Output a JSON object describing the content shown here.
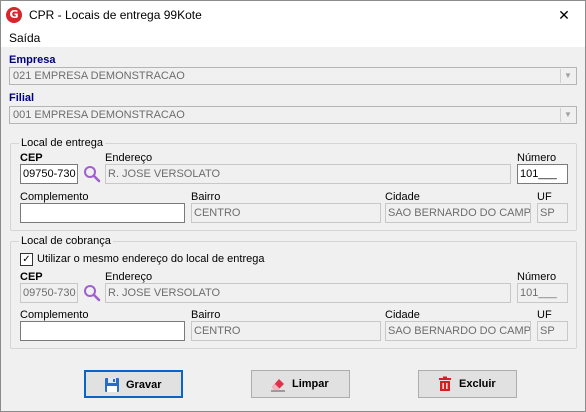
{
  "window": {
    "title": "CPR - Locais de entrega 99Kote",
    "app_icon": "G",
    "close_glyph": "✕"
  },
  "menu": {
    "items": [
      "Saída"
    ]
  },
  "empresa": {
    "label": "Empresa",
    "value": "021 EMPRESA DEMONSTRACAO"
  },
  "filial": {
    "label": "Filial",
    "value": "001 EMPRESA DEMONSTRACAO"
  },
  "entrega": {
    "title": "Local de entrega",
    "cep_label": "CEP",
    "cep": "09750-730",
    "endereco_label": "Endereço",
    "endereco": "R. JOSE VERSOLATO",
    "numero_label": "Número",
    "numero": "101___",
    "complemento_label": "Complemento",
    "complemento": "",
    "bairro_label": "Bairro",
    "bairro": "CENTRO",
    "cidade_label": "Cidade",
    "cidade": "SAO BERNARDO DO CAMPO",
    "uf_label": "UF",
    "uf": "SP"
  },
  "cobranca": {
    "title": "Local de cobrança",
    "same_address_label": "Utilizar o mesmo endereço do local de entrega",
    "same_address_checked": true,
    "check_glyph": "✓",
    "cep_label": "CEP",
    "cep": "09750-730",
    "endereco_label": "Endereço",
    "endereco": "R. JOSE VERSOLATO",
    "numero_label": "Número",
    "numero": "101___",
    "complemento_label": "Complemento",
    "complemento": "",
    "bairro_label": "Bairro",
    "bairro": "CENTRO",
    "cidade_label": "Cidade",
    "cidade": "SAO BERNARDO DO CAMPO",
    "uf_label": "UF",
    "uf": "SP"
  },
  "buttons": {
    "gravar": "Gravar",
    "limpar": "Limpar",
    "excluir": "Excluir"
  },
  "colors": {
    "label_blue": "#000080",
    "default_border": "#0a64c8",
    "brand_red": "#d6262b"
  },
  "icons": {
    "search": "search-icon",
    "save": "floppy-disk-icon",
    "clear": "eraser-icon",
    "delete": "trash-icon"
  }
}
